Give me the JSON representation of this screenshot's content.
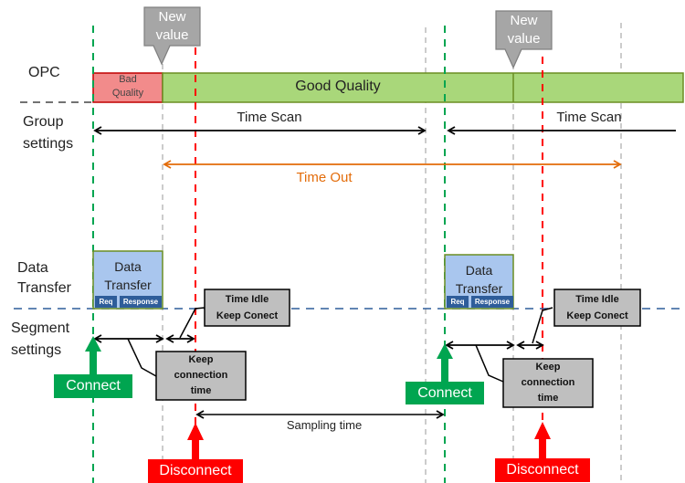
{
  "row_labels": {
    "opc": "OPC",
    "group_line1": "Group",
    "group_line2": "settings",
    "data_line1": "Data",
    "data_line2": "Transfer",
    "segment_line1": "Segment",
    "segment_line2": "settings"
  },
  "opc": {
    "bad_quality_line1": "Bad",
    "bad_quality_line2": "Quality",
    "good_quality": "Good Quality",
    "new_value_line1": "New",
    "new_value_line2": "value"
  },
  "group": {
    "time_scan": "Time Scan",
    "time_out": "Time Out"
  },
  "data_transfer": {
    "title_line1": "Data",
    "title_line2": "Transfer",
    "req": "Req",
    "response": "Response"
  },
  "segment": {
    "time_idle_line1": "Time Idle",
    "time_idle_line2": "Keep Conect",
    "keep_conn_line1": "Keep",
    "keep_conn_line2": "connection",
    "keep_conn_line3": "time",
    "connect": "Connect",
    "disconnect": "Disconnect",
    "sampling_time": "Sampling time"
  },
  "colors": {
    "green": "#00a550",
    "red": "#ff0000",
    "orange": "#e36c0a",
    "good_fill": "#a9d77a",
    "bad_fill": "#f28b8b",
    "callout_gray": "#a6a6a6",
    "box_gray": "#bfbfbf",
    "blue_fill": "#a9c6ee",
    "navy": "#2e5d9a"
  }
}
